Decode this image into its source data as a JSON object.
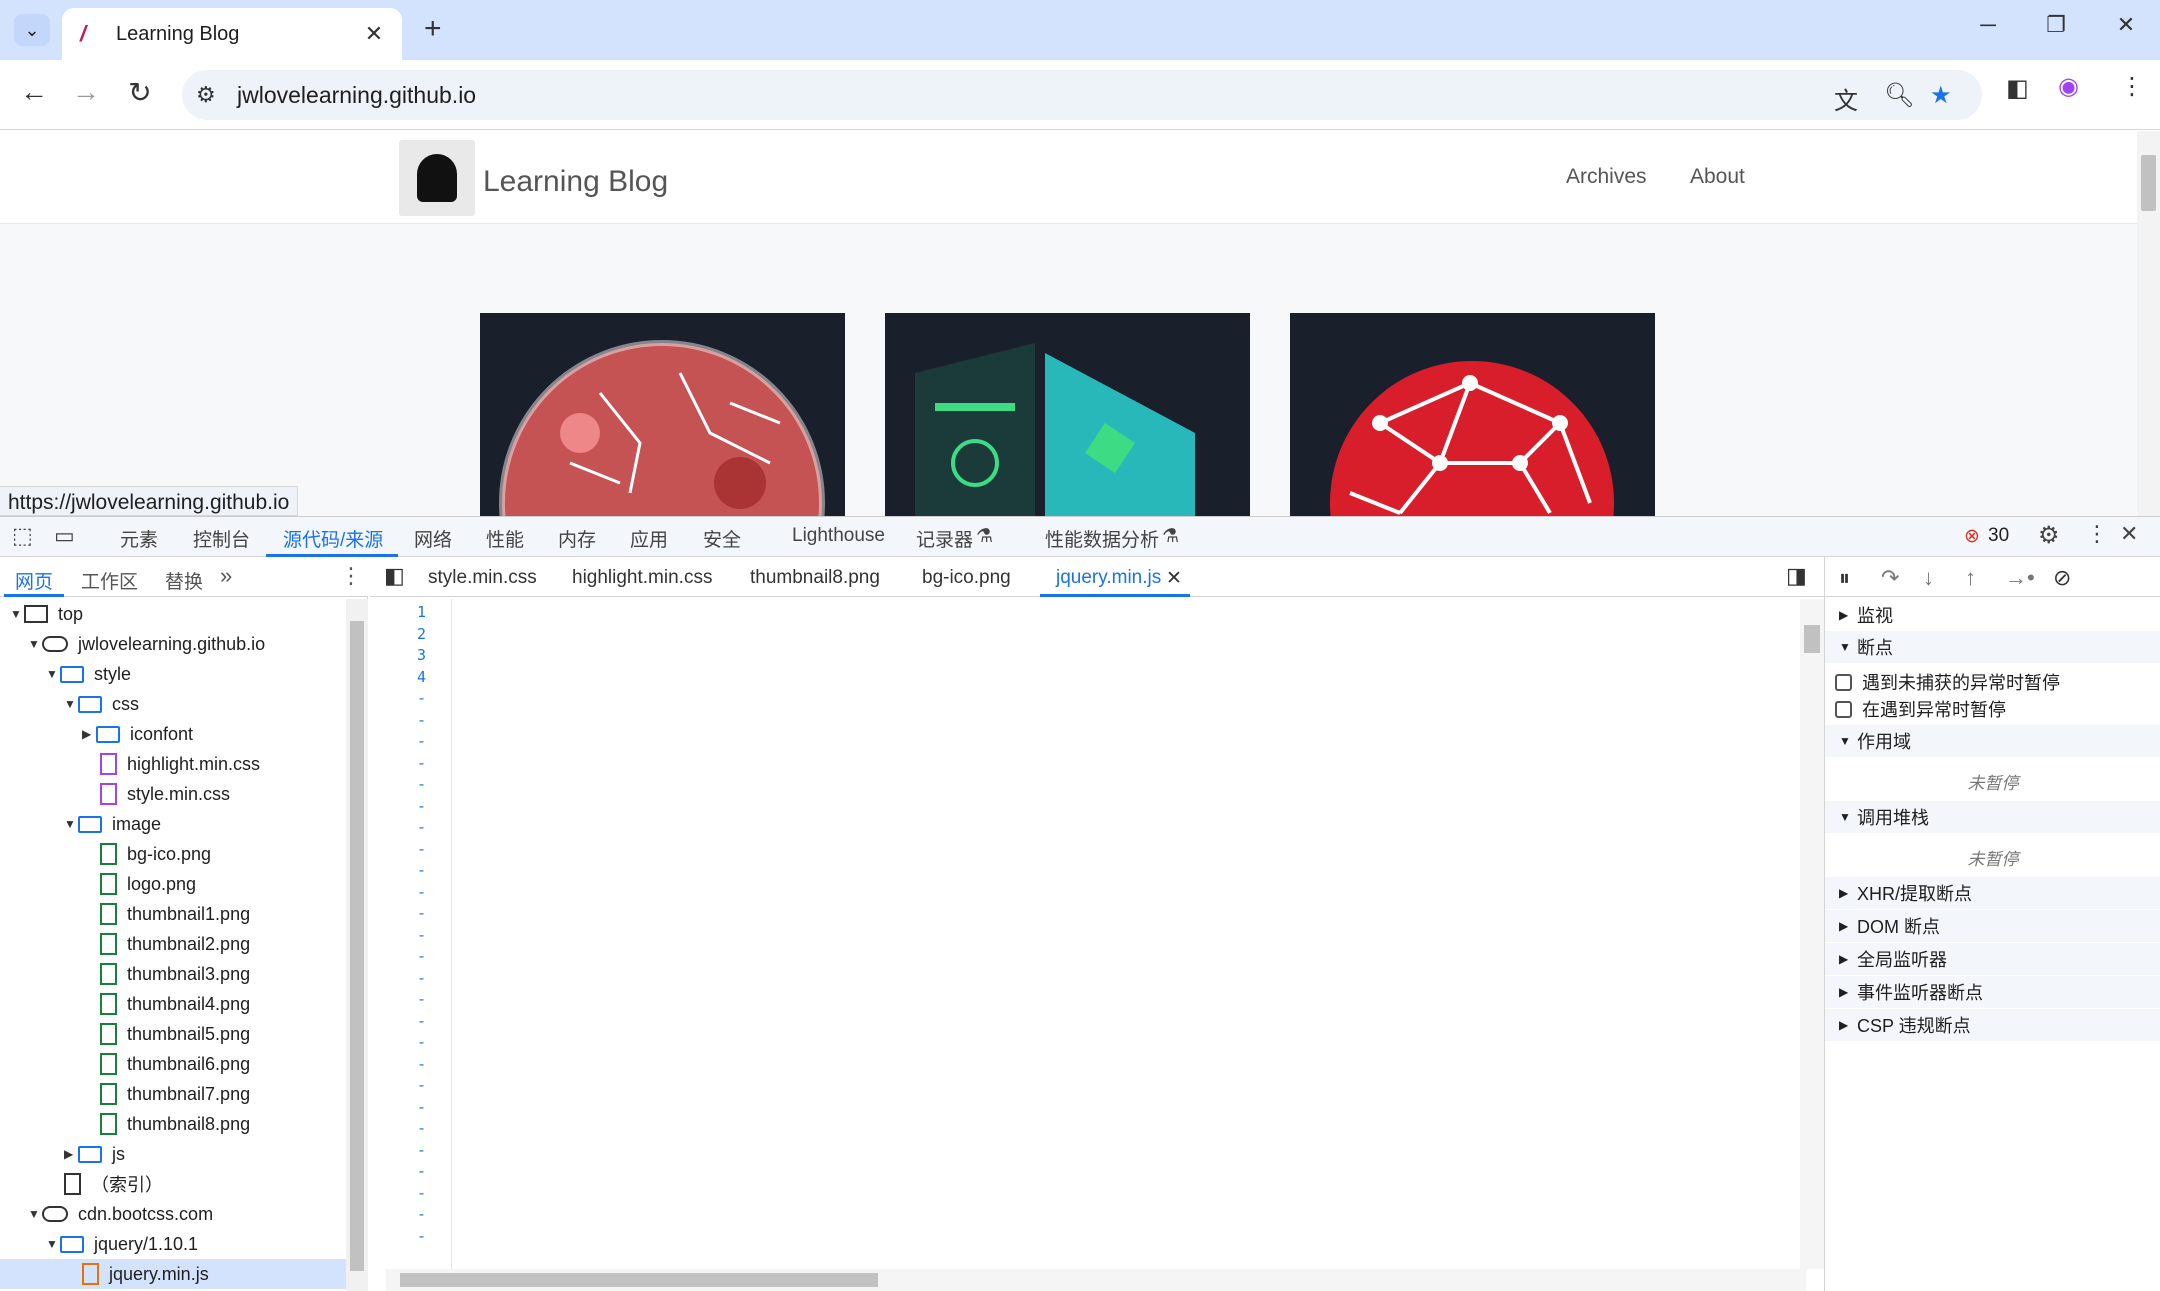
{
  "browser": {
    "tab_title": "Learning Blog",
    "url": "jwlovelearning.github.io",
    "status_url": "https://jwlovelearning.github.io"
  },
  "page": {
    "blog_title": "Learning Blog",
    "nav": [
      "Archives",
      "About"
    ]
  },
  "devtools": {
    "tabs": [
      "元素",
      "控制台",
      "源代码/来源",
      "网络",
      "性能",
      "内存",
      "应用",
      "安全",
      "Lighthouse",
      "记录器",
      "性能数据分析"
    ],
    "error_count": "30",
    "nav_tabs": [
      "网页",
      "工作区",
      "替换"
    ],
    "tree": [
      "top",
      "jwlovelearning.github.io",
      "style",
      "css",
      "iconfont",
      "highlight.min.css",
      "style.min.css",
      "image",
      "bg-ico.png",
      "logo.png",
      "thumbnail1.png",
      "thumbnail2.png",
      "thumbnail3.png",
      "thumbnail4.png",
      "thumbnail5.png",
      "thumbnail6.png",
      "thumbnail7.png",
      "thumbnail8.png",
      "js",
      "（索引）",
      "cdn.bootcss.com",
      "jquery/1.10.1",
      "jquery.min.js"
    ],
    "open_files": [
      "style.min.css",
      "highlight.min.css",
      "thumbnail8.png",
      "bg-ico.png",
      "jquery.min.js"
    ],
    "line_numbers": [
      "1",
      "2",
      "3",
      "4",
      "-",
      "-",
      "-",
      "-",
      "-",
      "-",
      "-",
      "-",
      "-",
      "-",
      "-",
      "-",
      "-",
      "-",
      "-",
      "-",
      "-",
      "-",
      "-",
      "-",
      "-",
      "-",
      "-",
      "-",
      "-",
      "-"
    ],
    "debugger": {
      "watch": "监视",
      "breakpoints": "断点",
      "pause_uncaught": "遇到未捕获的异常时暂停",
      "pause_caught": "在遇到异常时暂停",
      "scope": "作用域",
      "not_paused_1": "未暂停",
      "call_stack": "调用堆栈",
      "not_paused_2": "未暂停",
      "xhr": "XHR/提取断点",
      "dom": "DOM 断点",
      "global": "全局监听器",
      "event": "事件监听器断点",
      "csp": "CSP 违规断点"
    }
  },
  "colors": {
    "accent": "#1a73e8",
    "tab_strip": "#d3e3fd",
    "keyword": "#9c27b0",
    "string": "#c5221f",
    "comment": "#188038"
  }
}
